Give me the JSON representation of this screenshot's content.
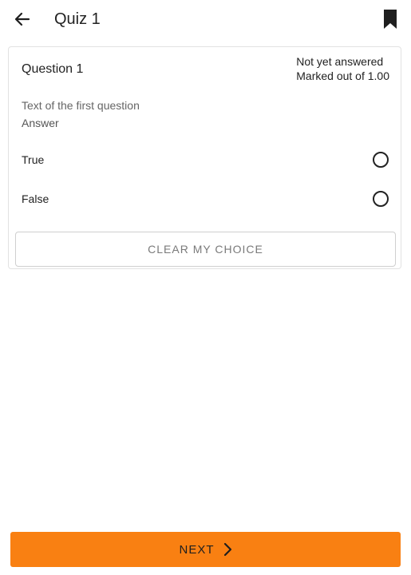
{
  "header": {
    "title": "Quiz 1",
    "back_icon": "arrow-back-icon",
    "bookmark_icon": "bookmark-icon"
  },
  "question": {
    "title": "Question 1",
    "status": "Not yet answered",
    "marks": "Marked out of 1.00",
    "text": "Text of the first question",
    "answer_label": "Answer",
    "options": [
      {
        "label": "True",
        "selected": false
      },
      {
        "label": "False",
        "selected": false
      }
    ],
    "clear_label": "CLEAR MY CHOICE"
  },
  "footer": {
    "next_label": "NEXT",
    "next_icon": "chevron-right-icon"
  },
  "colors": {
    "accent": "#f98012",
    "border": "#e2e2e2"
  }
}
